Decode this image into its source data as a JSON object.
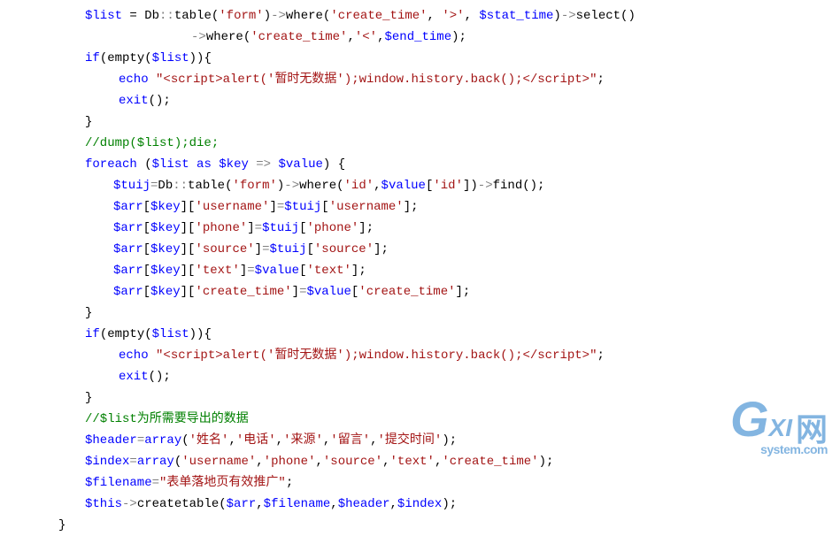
{
  "logo": {
    "g": "G",
    "xi": "XI",
    "wang": "网",
    "dom": "system.com"
  },
  "lines": [
    {
      "cls": "indent1",
      "spans": [
        {
          "c": "v",
          "t": "$list"
        },
        {
          "c": "nm",
          "t": " = Db"
        },
        {
          "c": "op",
          "t": "::"
        },
        {
          "c": "fn",
          "t": "table"
        },
        {
          "c": "pn",
          "t": "("
        },
        {
          "c": "str",
          "t": "'form'"
        },
        {
          "c": "pn",
          "t": ")"
        },
        {
          "c": "op",
          "t": "->"
        },
        {
          "c": "fn",
          "t": "where"
        },
        {
          "c": "pn",
          "t": "("
        },
        {
          "c": "str",
          "t": "'create_time'"
        },
        {
          "c": "pn",
          "t": ", "
        },
        {
          "c": "str",
          "t": "'>'"
        },
        {
          "c": "pn",
          "t": ", "
        },
        {
          "c": "v",
          "t": "$stat_time"
        },
        {
          "c": "pn",
          "t": ")"
        },
        {
          "c": "op",
          "t": "->"
        },
        {
          "c": "fn",
          "t": "select"
        },
        {
          "c": "pn",
          "t": "()"
        }
      ]
    },
    {
      "cls": "indentA",
      "spans": [
        {
          "c": "op",
          "t": "->"
        },
        {
          "c": "fn",
          "t": "where"
        },
        {
          "c": "pn",
          "t": "("
        },
        {
          "c": "str",
          "t": "'create_time'"
        },
        {
          "c": "pn",
          "t": ","
        },
        {
          "c": "str",
          "t": "'<'"
        },
        {
          "c": "pn",
          "t": ","
        },
        {
          "c": "v",
          "t": "$end_time"
        },
        {
          "c": "pn",
          "t": ");"
        }
      ]
    },
    {
      "cls": "indent1",
      "spans": [
        {
          "c": "kw",
          "t": "if"
        },
        {
          "c": "pn",
          "t": "("
        },
        {
          "c": "fn",
          "t": "empty"
        },
        {
          "c": "pn",
          "t": "("
        },
        {
          "c": "v",
          "t": "$list"
        },
        {
          "c": "pn",
          "t": "))"
        },
        {
          "c": "pn",
          "t": "{"
        }
      ]
    },
    {
      "cls": "indent3",
      "spans": [
        {
          "c": "kw",
          "t": "echo"
        },
        {
          "c": "nm",
          "t": " "
        },
        {
          "c": "str",
          "t": "\"<script>alert('暂时无数据');window.history.back();</script>\""
        },
        {
          "c": "pn",
          "t": ";"
        }
      ]
    },
    {
      "cls": "indent3",
      "spans": [
        {
          "c": "kw",
          "t": "exit"
        },
        {
          "c": "pn",
          "t": "();"
        }
      ]
    },
    {
      "cls": "indent1",
      "spans": [
        {
          "c": "pn",
          "t": "}"
        }
      ]
    },
    {
      "cls": "indent1",
      "spans": [
        {
          "c": "cm",
          "t": "//dump($list);die;"
        }
      ]
    },
    {
      "cls": "indent1",
      "spans": [
        {
          "c": "kw",
          "t": "foreach"
        },
        {
          "c": "nm",
          "t": " "
        },
        {
          "c": "pn",
          "t": "("
        },
        {
          "c": "v",
          "t": "$list"
        },
        {
          "c": "nm",
          "t": " "
        },
        {
          "c": "kw",
          "t": "as"
        },
        {
          "c": "nm",
          "t": " "
        },
        {
          "c": "v",
          "t": "$key"
        },
        {
          "c": "nm",
          "t": " "
        },
        {
          "c": "op",
          "t": "=>"
        },
        {
          "c": "nm",
          "t": " "
        },
        {
          "c": "v",
          "t": "$value"
        },
        {
          "c": "pn",
          "t": ") {"
        }
      ]
    },
    {
      "cls": "indent2",
      "spans": [
        {
          "c": "v",
          "t": "$tuij"
        },
        {
          "c": "op",
          "t": "="
        },
        {
          "c": "nm",
          "t": "Db"
        },
        {
          "c": "op",
          "t": "::"
        },
        {
          "c": "fn",
          "t": "table"
        },
        {
          "c": "pn",
          "t": "("
        },
        {
          "c": "str",
          "t": "'form'"
        },
        {
          "c": "pn",
          "t": ")"
        },
        {
          "c": "op",
          "t": "->"
        },
        {
          "c": "fn",
          "t": "where"
        },
        {
          "c": "pn",
          "t": "("
        },
        {
          "c": "str",
          "t": "'id'"
        },
        {
          "c": "pn",
          "t": ","
        },
        {
          "c": "v",
          "t": "$value"
        },
        {
          "c": "pn",
          "t": "["
        },
        {
          "c": "str",
          "t": "'id'"
        },
        {
          "c": "pn",
          "t": "])"
        },
        {
          "c": "op",
          "t": "->"
        },
        {
          "c": "fn",
          "t": "find"
        },
        {
          "c": "pn",
          "t": "();"
        }
      ]
    },
    {
      "cls": "indent2",
      "spans": [
        {
          "c": "v",
          "t": "$arr"
        },
        {
          "c": "pn",
          "t": "["
        },
        {
          "c": "v",
          "t": "$key"
        },
        {
          "c": "pn",
          "t": "]["
        },
        {
          "c": "str",
          "t": "'username'"
        },
        {
          "c": "pn",
          "t": "]"
        },
        {
          "c": "op",
          "t": "="
        },
        {
          "c": "v",
          "t": "$tuij"
        },
        {
          "c": "pn",
          "t": "["
        },
        {
          "c": "str",
          "t": "'username'"
        },
        {
          "c": "pn",
          "t": "];"
        }
      ]
    },
    {
      "cls": "indent2",
      "spans": [
        {
          "c": "v",
          "t": "$arr"
        },
        {
          "c": "pn",
          "t": "["
        },
        {
          "c": "v",
          "t": "$key"
        },
        {
          "c": "pn",
          "t": "]["
        },
        {
          "c": "str",
          "t": "'phone'"
        },
        {
          "c": "pn",
          "t": "]"
        },
        {
          "c": "op",
          "t": "="
        },
        {
          "c": "v",
          "t": "$tuij"
        },
        {
          "c": "pn",
          "t": "["
        },
        {
          "c": "str",
          "t": "'phone'"
        },
        {
          "c": "pn",
          "t": "];"
        }
      ]
    },
    {
      "cls": "indent2",
      "spans": [
        {
          "c": "v",
          "t": "$arr"
        },
        {
          "c": "pn",
          "t": "["
        },
        {
          "c": "v",
          "t": "$key"
        },
        {
          "c": "pn",
          "t": "]["
        },
        {
          "c": "str",
          "t": "'source'"
        },
        {
          "c": "pn",
          "t": "]"
        },
        {
          "c": "op",
          "t": "="
        },
        {
          "c": "v",
          "t": "$tuij"
        },
        {
          "c": "pn",
          "t": "["
        },
        {
          "c": "str",
          "t": "'source'"
        },
        {
          "c": "pn",
          "t": "];"
        }
      ]
    },
    {
      "cls": "indent2",
      "spans": [
        {
          "c": "v",
          "t": "$arr"
        },
        {
          "c": "pn",
          "t": "["
        },
        {
          "c": "v",
          "t": "$key"
        },
        {
          "c": "pn",
          "t": "]["
        },
        {
          "c": "str",
          "t": "'text'"
        },
        {
          "c": "pn",
          "t": "]"
        },
        {
          "c": "op",
          "t": "="
        },
        {
          "c": "v",
          "t": "$value"
        },
        {
          "c": "pn",
          "t": "["
        },
        {
          "c": "str",
          "t": "'text'"
        },
        {
          "c": "pn",
          "t": "];"
        }
      ]
    },
    {
      "cls": "indent2",
      "spans": [
        {
          "c": "v",
          "t": "$arr"
        },
        {
          "c": "pn",
          "t": "["
        },
        {
          "c": "v",
          "t": "$key"
        },
        {
          "c": "pn",
          "t": "]["
        },
        {
          "c": "str",
          "t": "'create_time'"
        },
        {
          "c": "pn",
          "t": "]"
        },
        {
          "c": "op",
          "t": "="
        },
        {
          "c": "v",
          "t": "$value"
        },
        {
          "c": "pn",
          "t": "["
        },
        {
          "c": "str",
          "t": "'create_time'"
        },
        {
          "c": "pn",
          "t": "];"
        }
      ]
    },
    {
      "cls": "indent1",
      "spans": [
        {
          "c": "pn",
          "t": "}"
        }
      ]
    },
    {
      "cls": "indent1",
      "spans": [
        {
          "c": "kw",
          "t": "if"
        },
        {
          "c": "pn",
          "t": "("
        },
        {
          "c": "fn",
          "t": "empty"
        },
        {
          "c": "pn",
          "t": "("
        },
        {
          "c": "v",
          "t": "$list"
        },
        {
          "c": "pn",
          "t": "))"
        },
        {
          "c": "pn",
          "t": "{"
        }
      ]
    },
    {
      "cls": "indent3",
      "spans": [
        {
          "c": "kw",
          "t": "echo"
        },
        {
          "c": "nm",
          "t": " "
        },
        {
          "c": "str",
          "t": "\"<script>alert('暂时无数据');window.history.back();</script>\""
        },
        {
          "c": "pn",
          "t": ";"
        }
      ]
    },
    {
      "cls": "indent3",
      "spans": [
        {
          "c": "kw",
          "t": "exit"
        },
        {
          "c": "pn",
          "t": "();"
        }
      ]
    },
    {
      "cls": "indent1",
      "spans": [
        {
          "c": "pn",
          "t": "}"
        }
      ]
    },
    {
      "cls": "indent1",
      "spans": [
        {
          "c": "cm",
          "t": "//$list为所需要导出的数据"
        }
      ]
    },
    {
      "cls": "indent1",
      "spans": [
        {
          "c": "v",
          "t": "$header"
        },
        {
          "c": "op",
          "t": "="
        },
        {
          "c": "kw",
          "t": "array"
        },
        {
          "c": "pn",
          "t": "("
        },
        {
          "c": "str",
          "t": "'姓名'"
        },
        {
          "c": "pn",
          "t": ","
        },
        {
          "c": "str",
          "t": "'电话'"
        },
        {
          "c": "pn",
          "t": ","
        },
        {
          "c": "str",
          "t": "'来源'"
        },
        {
          "c": "pn",
          "t": ","
        },
        {
          "c": "str",
          "t": "'留言'"
        },
        {
          "c": "pn",
          "t": ","
        },
        {
          "c": "str",
          "t": "'提交时间'"
        },
        {
          "c": "pn",
          "t": ");"
        }
      ]
    },
    {
      "cls": "indent1",
      "spans": [
        {
          "c": "v",
          "t": "$index"
        },
        {
          "c": "op",
          "t": "="
        },
        {
          "c": "kw",
          "t": "array"
        },
        {
          "c": "pn",
          "t": "("
        },
        {
          "c": "str",
          "t": "'username'"
        },
        {
          "c": "pn",
          "t": ","
        },
        {
          "c": "str",
          "t": "'phone'"
        },
        {
          "c": "pn",
          "t": ","
        },
        {
          "c": "str",
          "t": "'source'"
        },
        {
          "c": "pn",
          "t": ","
        },
        {
          "c": "str",
          "t": "'text'"
        },
        {
          "c": "pn",
          "t": ","
        },
        {
          "c": "str",
          "t": "'create_time'"
        },
        {
          "c": "pn",
          "t": ");"
        }
      ]
    },
    {
      "cls": "indent1",
      "spans": [
        {
          "c": "v",
          "t": "$filename"
        },
        {
          "c": "op",
          "t": "="
        },
        {
          "c": "str",
          "t": "\"表单落地页有效推广\""
        },
        {
          "c": "pn",
          "t": ";"
        }
      ]
    },
    {
      "cls": "indent1",
      "spans": [
        {
          "c": "v",
          "t": "$this"
        },
        {
          "c": "op",
          "t": "->"
        },
        {
          "c": "fn",
          "t": "createtable"
        },
        {
          "c": "pn",
          "t": "("
        },
        {
          "c": "v",
          "t": "$arr"
        },
        {
          "c": "pn",
          "t": ","
        },
        {
          "c": "v",
          "t": "$filename"
        },
        {
          "c": "pn",
          "t": ","
        },
        {
          "c": "v",
          "t": "$header"
        },
        {
          "c": "pn",
          "t": ","
        },
        {
          "c": "v",
          "t": "$index"
        },
        {
          "c": "pn",
          "t": ");"
        }
      ]
    },
    {
      "cls": "indentB",
      "spans": [
        {
          "c": "pn",
          "t": "}"
        }
      ]
    }
  ]
}
